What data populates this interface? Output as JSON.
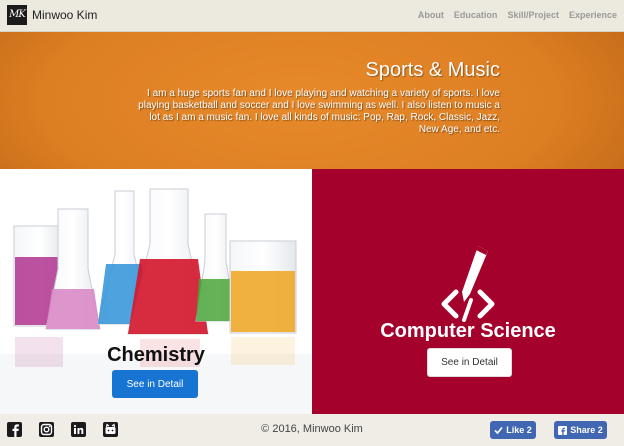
{
  "brand": {
    "logo_text": "MK",
    "name": "Minwoo Kim"
  },
  "nav": {
    "items": [
      "About",
      "Education",
      "Skill/Project",
      "Experience"
    ]
  },
  "hero": {
    "title": "Sports & Music",
    "text": "I am a huge sports fan and I love playing and watching a variety of sports. I love playing basketball and soccer and I love swimming as well. I also listen to music a lot as I am a music fan. I love all kinds of music: Pop, Rap, Rock, Classic, Jazz, New Age, and etc.",
    "background_color": "#dc7e22"
  },
  "panels": {
    "chemistry": {
      "title": "Chemistry",
      "button": "See in Detail",
      "button_color": "#1874d2"
    },
    "computer_science": {
      "title": "Computer Science",
      "button": "See in Detail",
      "background_color": "#a4022d",
      "icon": "code-pencil-icon"
    }
  },
  "footer": {
    "social_icons": [
      "facebook-icon",
      "instagram-icon",
      "linkedin-icon",
      "github-icon"
    ],
    "copyright": "© 2016, Minwoo Kim",
    "like_label": "Like 2",
    "share_label": "Share 2"
  }
}
